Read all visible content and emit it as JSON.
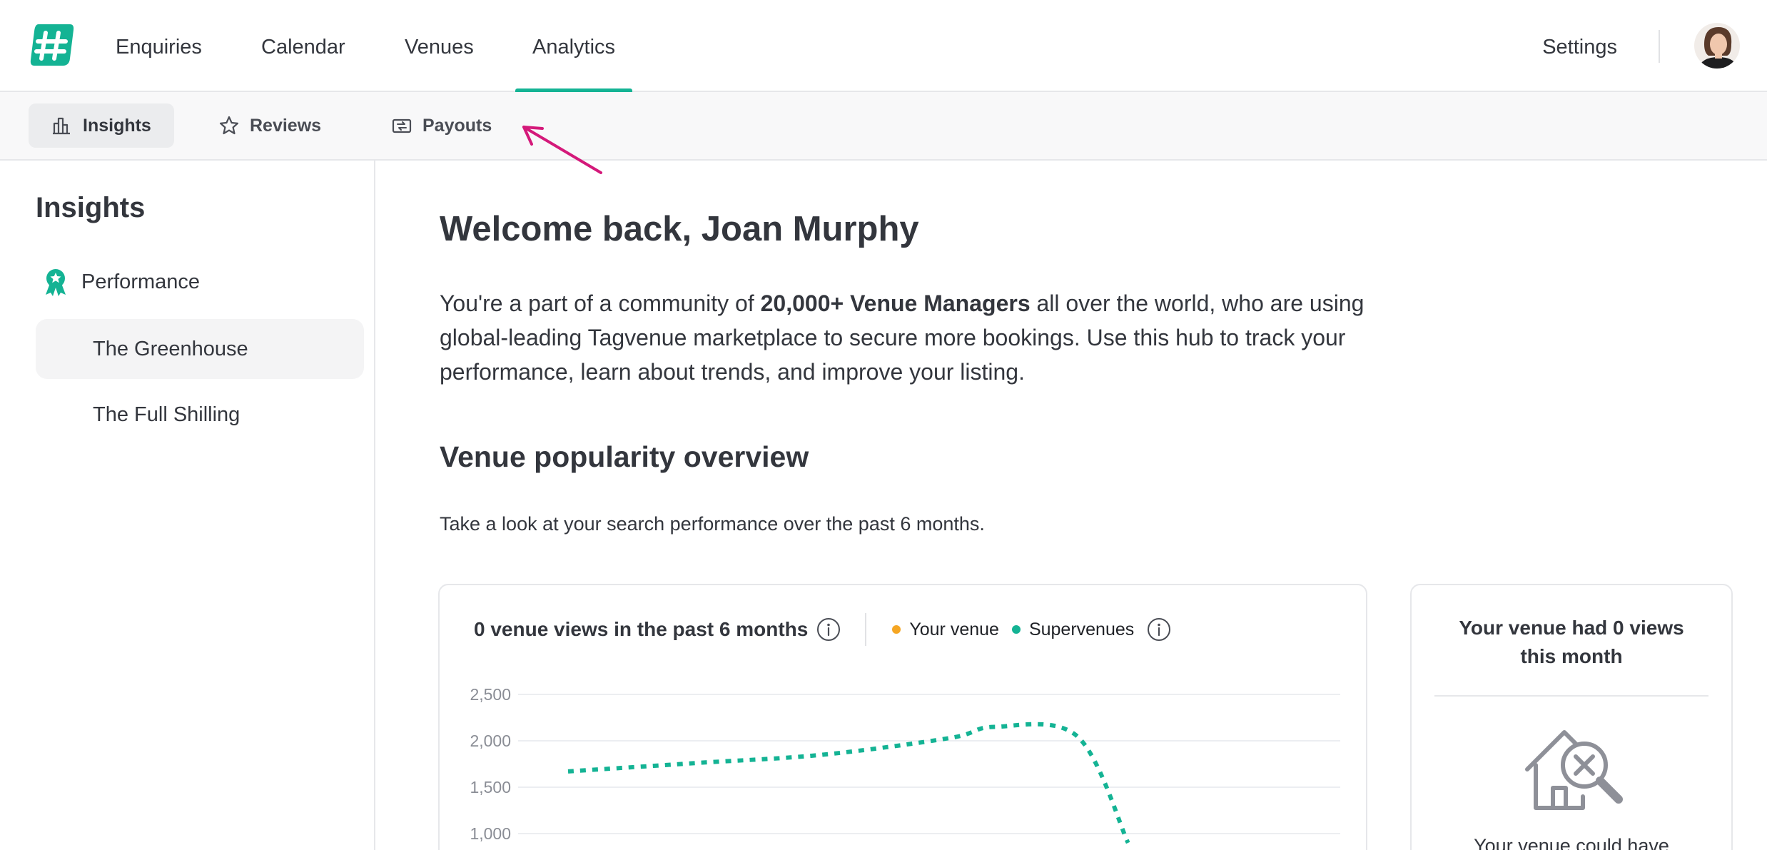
{
  "nav": {
    "items": [
      {
        "label": "Enquiries"
      },
      {
        "label": "Calendar"
      },
      {
        "label": "Venues"
      },
      {
        "label": "Analytics"
      }
    ],
    "active": "Analytics",
    "settings_label": "Settings",
    "accent_color": "#14b394"
  },
  "subnav": {
    "tabs": [
      {
        "label": "Insights",
        "icon": "bar-chart-icon"
      },
      {
        "label": "Reviews",
        "icon": "star-icon"
      },
      {
        "label": "Payouts",
        "icon": "payouts-icon"
      }
    ],
    "active": "Insights"
  },
  "sidebar": {
    "title": "Insights",
    "section_label": "Performance",
    "section_icon": "award-ribbon-icon",
    "venues": [
      {
        "label": "The Greenhouse",
        "selected": true
      },
      {
        "label": "The Full Shilling",
        "selected": false
      }
    ]
  },
  "main": {
    "welcome": "Welcome back, Joan Murphy",
    "intro_before": "You're a part of a community of ",
    "intro_bold": "20,000+ Venue Managers",
    "intro_after": " all over the world, who are using global-leading Tagvenue marketplace to secure more bookings. Use this hub to track your performance, learn about trends, and improve your listing.",
    "section_title": "Venue popularity overview",
    "section_subtitle": "Take a look at your search performance over the past 6 months."
  },
  "chart_card": {
    "title": "0 venue views in the past 6 months",
    "legend": [
      {
        "label": "Your venue",
        "color": "#f5a623"
      },
      {
        "label": "Supervenues",
        "color": "#14b394"
      }
    ]
  },
  "chart_data": {
    "type": "line",
    "title": "0 venue views in the past 6 months",
    "ylim": [
      0,
      2500
    ],
    "yticks": [
      "2,500",
      "2,000",
      "1,500",
      "1,000"
    ],
    "grid": true,
    "legend_placement": "top",
    "series": [
      {
        "name": "Supervenues",
        "style": "dotted",
        "color": "#14b394",
        "x": [
          0,
          1,
          2,
          3,
          3.35,
          4,
          4.4
        ],
        "values": [
          1670,
          1760,
          1850,
          2030,
          2150,
          2050,
          900
        ]
      },
      {
        "name": "Your venue",
        "color": "#f5a623",
        "values": [
          0,
          0,
          0,
          0,
          0,
          0
        ]
      }
    ]
  },
  "stat_card": {
    "title": "Your venue had 0 views this month",
    "icon": "house-search-icon",
    "text": "Your venue could have"
  }
}
